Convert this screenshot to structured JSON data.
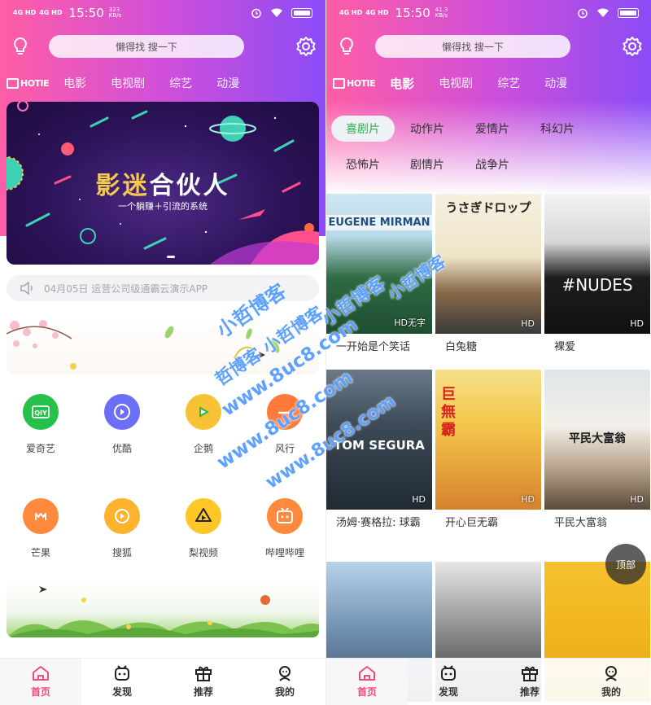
{
  "status_bar": {
    "signal1": "4G HD",
    "signal2": "4G HD",
    "time": "15:50",
    "left_speed": "323 KB/s",
    "right_speed": "41.3 KB/s"
  },
  "search": {
    "placeholder": "懒得找 搜一下"
  },
  "tabs": {
    "logo": "HOTIE",
    "items": [
      "电影",
      "电视剧",
      "综艺",
      "动漫"
    ],
    "right_active": "电影"
  },
  "banner": {
    "title_gold": "影迷",
    "title_rest": "合伙人",
    "subtitle": "一个躺赚＋引流的系统"
  },
  "notice": {
    "text": "04月05日 运营公司级通霸云演示APP"
  },
  "apps": [
    {
      "label": "爱奇艺",
      "icon": "iqiyi-icon",
      "color": "#25c14a"
    },
    {
      "label": "优酷",
      "icon": "youku-icon",
      "color": "#6c6ff5"
    },
    {
      "label": "企鹅",
      "icon": "tencent-icon",
      "color": "#f7c234"
    },
    {
      "label": "风行",
      "icon": "funshion-icon",
      "color": "#ff7a3a"
    },
    {
      "label": "芒果",
      "icon": "mango-icon",
      "color": "#ff8a3d"
    },
    {
      "label": "搜狐",
      "icon": "sohu-icon",
      "color": "#ffb22e"
    },
    {
      "label": "梨视频",
      "icon": "pear-icon",
      "color": "#ffc628"
    },
    {
      "label": "哔哩哔哩",
      "icon": "bilibili-icon",
      "color": "#ff8a3d"
    }
  ],
  "bottom_nav": [
    {
      "label": "首页",
      "icon": "home-icon"
    },
    {
      "label": "发现",
      "icon": "discover-icon"
    },
    {
      "label": "推荐",
      "icon": "gift-icon"
    },
    {
      "label": "我的",
      "icon": "profile-icon"
    }
  ],
  "categories": [
    "喜剧片",
    "动作片",
    "爱情片",
    "科幻片",
    "恐怖片",
    "剧情片",
    "战争片"
  ],
  "movies": [
    {
      "title": "一开始是个笑话",
      "badge": "HD无字",
      "poster_text": "EUGENE MIRMAN"
    },
    {
      "title": "白兔糖",
      "badge": "HD",
      "poster_text": "うさぎドロップ"
    },
    {
      "title": "裸爱",
      "badge": "HD",
      "poster_text": "#NUDES"
    },
    {
      "title": "汤姆·赛格拉: 球霸",
      "badge": "HD",
      "poster_text": "TOM SEGURA"
    },
    {
      "title": "开心巨无霸",
      "badge": "HD",
      "poster_text": "巨無霸"
    },
    {
      "title": "平民大富翁",
      "badge": "HD",
      "poster_text": "平民大富翁"
    }
  ],
  "top_button": "顶部",
  "watermarks": [
    "小哲博客",
    "小哲博客",
    "www.8uc8.com",
    "哲博客 小哲博客",
    "www.8uc8.com",
    "www.8uc8.com",
    "小哲博客"
  ]
}
